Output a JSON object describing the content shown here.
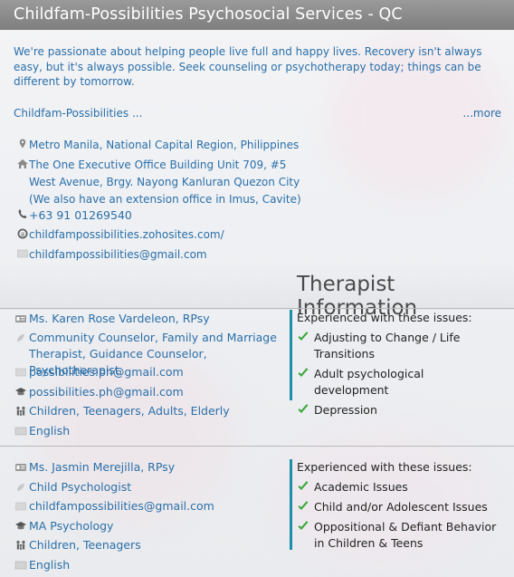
{
  "header": {
    "title": "Childfam-Possibilities Psychosocial Services - QC"
  },
  "intro": {
    "text": "We're passionate about helping people live full and happy lives. Recovery isn't always easy, but it's always possible. Seek counseling or psychotherapy today; things can be different by tomorrow.",
    "agency_name": "Childfam-Possibilities ...",
    "more_link": "...more"
  },
  "contact": {
    "location": "Metro Manila, National Capital Region, Philippines",
    "address": "The One Executive Office Building Unit 709, #5 West Avenue, Brgy. Nayong Kanluran Quezon City (We also have an extension office in Imus, Cavite)",
    "phone": "+63 91 01269540",
    "website": "childfampossibilities.zohosites.com/",
    "email": "childfampossibilities@gmail.com"
  },
  "therapist_section": {
    "heading": "Therapist Information"
  },
  "therapists": [
    {
      "name": "Ms. Karen Rose Vardeleon, RPsy",
      "role": "Community Counselor, Family and Marriage Therapist, Guidance Counselor, Psychotherapist",
      "email": "possibilities.ph@gmail.com",
      "education": "possibilities.ph@gmail.com",
      "ages": "Children, Teenagers, Adults, Elderly",
      "language": "English",
      "issues_title": "Experienced with these issues:",
      "issues": [
        "Adjusting to Change / Life Transitions",
        "Adult psychological development",
        "Depression"
      ]
    },
    {
      "name": "Ms. Jasmin Merejilla, RPsy",
      "role": "Child Psychologist",
      "email": "childfampossibilities@gmail.com",
      "education": "MA Psychology",
      "ages": "Children, Teenagers",
      "language": "English",
      "issues_title": "Experienced with these issues:",
      "issues": [
        "Academic Issues",
        "Child and/or Adolescent Issues",
        "Oppositional & Defiant Behavior in Children & Teens"
      ]
    }
  ],
  "colors": {
    "title_bar": "#888888",
    "link_blue": "#2a6fa8",
    "accent_teal": "#1e8fa8",
    "check_green": "#3aa83a"
  }
}
